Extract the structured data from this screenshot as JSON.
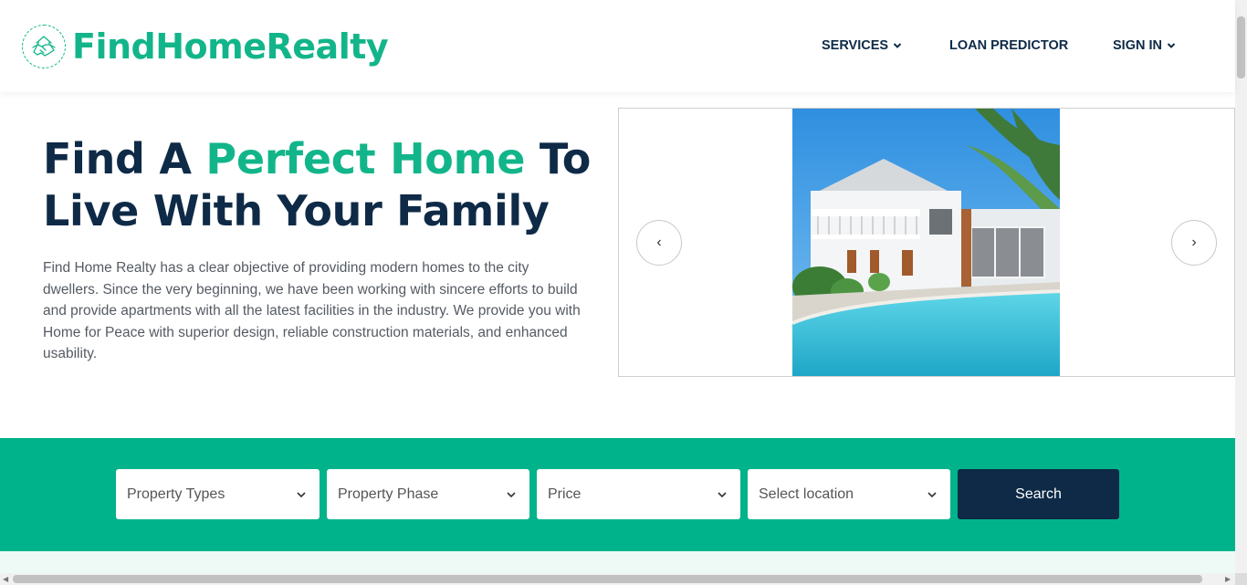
{
  "header": {
    "brand": "FindHomeRealty",
    "nav": {
      "services": "SERVICES",
      "loan_predictor": "LOAN PREDICTOR",
      "sign_in": "SIGN IN"
    }
  },
  "hero": {
    "title_part1": "Find A ",
    "title_accent": "Perfect Home",
    "title_part2": " To Live With Your Family",
    "description": "Find Home Realty has a clear objective of providing modern homes to the city dwellers. Since the very beginning, we have been working with sincere efforts to build and provide apartments with all the latest facilities in the industry. We provide you with Home for Peace with superior design, reliable construction materials, and enhanced usability."
  },
  "carousel": {
    "prev_label": "‹",
    "next_label": "›"
  },
  "search": {
    "property_types": "Property Types",
    "property_phase": "Property Phase",
    "price": "Price",
    "location": "Select location",
    "button": "Search"
  },
  "colors": {
    "brand_green": "#12b589",
    "navy": "#0e2a47",
    "band_green": "#00b38a"
  },
  "icons": {
    "logo": "handshake-house-icon",
    "dropdown": "chevron-down-icon"
  }
}
